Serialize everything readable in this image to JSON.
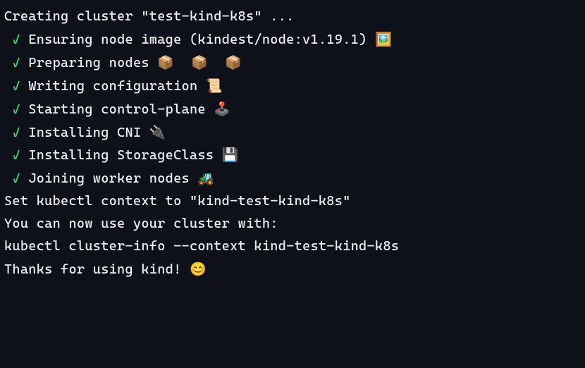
{
  "creating_line": "Creating cluster \"test-kind-k8s\" ...",
  "checkmark": "✓",
  "steps": [
    {
      "text": "Ensuring node image (kindest/node:v1.19.1) ",
      "emoji": "🖼"
    },
    {
      "text": "Preparing nodes ",
      "emoji": "📦 📦 📦"
    },
    {
      "text": "Writing configuration ",
      "emoji": "📜"
    },
    {
      "text": "Starting control-plane ",
      "emoji": "🕹️"
    },
    {
      "text": "Installing CNI ",
      "emoji": "🔌"
    },
    {
      "text": "Installing StorageClass ",
      "emoji": "💾"
    },
    {
      "text": "Joining worker nodes ",
      "emoji": "🚜"
    }
  ],
  "context_line": "Set kubectl context to \"kind-test-kind-k8s\"",
  "use_line": "You can now use your cluster with:",
  "blank": "",
  "command_line": "kubectl cluster-info --context kind-test-kind-k8s",
  "thanks_prefix": "Thanks for using kind! ",
  "thanks_emoji": "😊"
}
